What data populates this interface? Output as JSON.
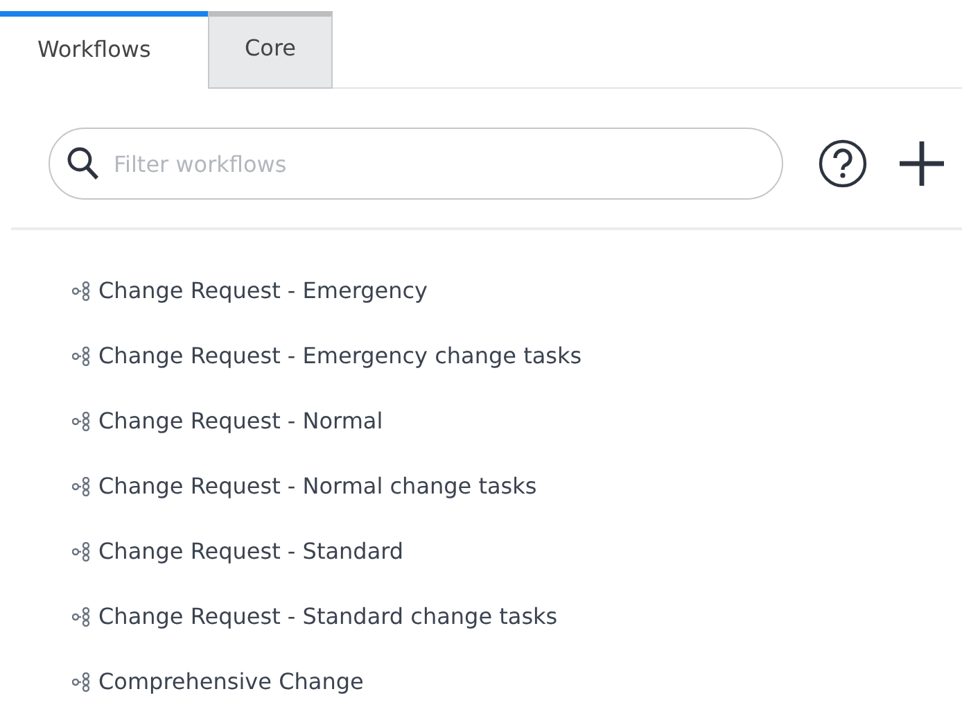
{
  "tabs": [
    {
      "label": "Workflows",
      "selected": true
    },
    {
      "label": "Core",
      "selected": false
    }
  ],
  "search": {
    "placeholder": "Filter workflows"
  },
  "workflows": [
    {
      "name": "Change Request - Emergency"
    },
    {
      "name": "Change Request - Emergency change tasks"
    },
    {
      "name": "Change Request - Normal"
    },
    {
      "name": "Change Request - Normal change tasks"
    },
    {
      "name": "Change Request - Standard"
    },
    {
      "name": "Change Request - Standard change tasks"
    },
    {
      "name": "Comprehensive Change"
    }
  ]
}
